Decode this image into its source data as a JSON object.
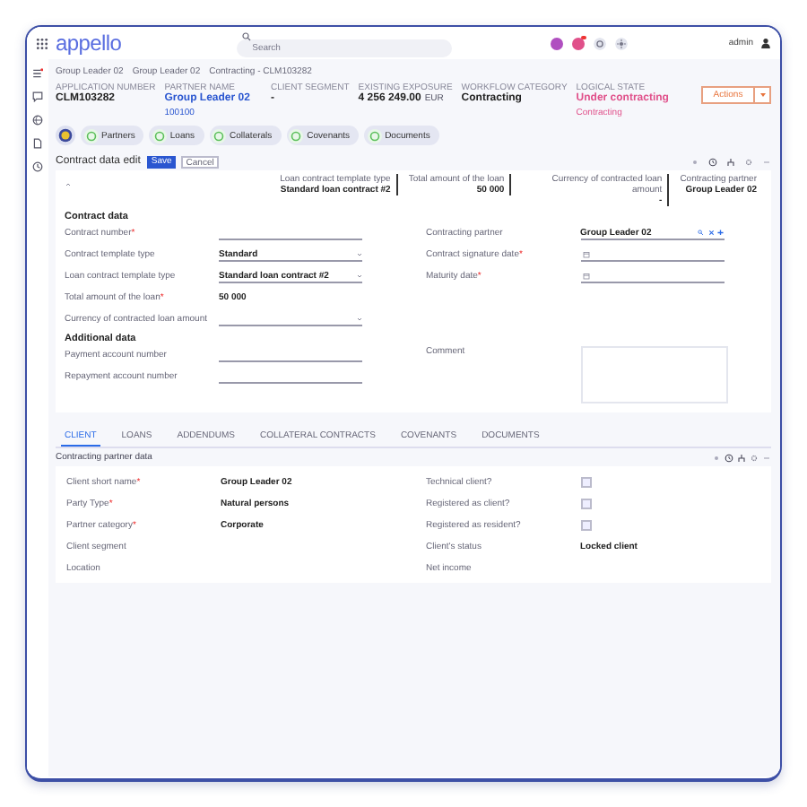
{
  "header": {
    "logo": "appello",
    "search": {
      "placeholder": "Search"
    },
    "user": "admin"
  },
  "breadcrumb": [
    "Group Leader 02",
    "Group Leader 02",
    "Contracting - CLM103282"
  ],
  "summary": [
    {
      "label": "APPLICATION NUMBER",
      "value": "CLM103282",
      "kind": "plain"
    },
    {
      "label": "PARTNER NAME",
      "value": "Group Leader 02",
      "note": "100100",
      "kind": "link"
    },
    {
      "label": "CLIENT SEGMENT",
      "value": "-",
      "kind": "plain"
    },
    {
      "label": "EXISTING EXPOSURE",
      "value": "4 256 249.00",
      "note": "EUR",
      "kind": "plain"
    },
    {
      "label": "WORKFLOW CATEGORY",
      "value": "Contracting",
      "kind": "plain"
    },
    {
      "label": "LOGICAL STATE",
      "value": "Under contracting",
      "note": "Contracting",
      "kind": "alert"
    }
  ],
  "actions_button": "Actions",
  "quick_links": [
    "Partners",
    "Loans",
    "Collaterals",
    "Covenants",
    "Documents"
  ],
  "edit": {
    "title": "Contract data edit",
    "save": "Save",
    "cancel": "Cancel",
    "strip": [
      {
        "label": "Loan contract template type",
        "value": "Standard loan contract #2"
      },
      {
        "label": "Total amount of the loan",
        "value": "50 000"
      },
      {
        "label": "Currency of contracted loan amount",
        "value": "-"
      },
      {
        "label": "Contracting partner",
        "value": "Group Leader 02"
      }
    ],
    "section": "Contract data",
    "left": [
      {
        "label": "Contract number",
        "mark": "*",
        "kind": "text"
      },
      {
        "label": "Contract template type",
        "value": "Standard",
        "kind": "select"
      },
      {
        "label": "Loan contract template type",
        "value": "Standard loan contract #2",
        "kind": "select"
      },
      {
        "label": "Total amount of the loan",
        "mark": "*",
        "value": "50 000",
        "kind": "readonly"
      },
      {
        "label": "Currency of contracted loan amount",
        "kind": "select"
      }
    ],
    "right": [
      {
        "label": "Contracting partner",
        "value": "Group Leader 02",
        "kind": "partner"
      },
      {
        "label": "Contract signature date",
        "mark": "*",
        "kind": "date"
      },
      {
        "label": "Maturity date",
        "mark": "*",
        "kind": "date"
      }
    ],
    "additional": "Additional data",
    "additional_fields": [
      {
        "label": "Payment account number",
        "kind": "text"
      },
      {
        "label": "Repayment account number",
        "kind": "text"
      }
    ],
    "comment": "Comment"
  },
  "tabs": [
    {
      "label": "CLIENT",
      "selected": true
    },
    {
      "label": "LOANS",
      "selected": false
    },
    {
      "label": "ADDENDUMS",
      "selected": false
    },
    {
      "label": "COLLATERAL CONTRACTS",
      "selected": false
    },
    {
      "label": "COVENANTS",
      "selected": false
    },
    {
      "label": "DOCUMENTS",
      "selected": false
    }
  ],
  "partner_panel": {
    "title": "Contracting partner data",
    "left": [
      {
        "label": "Client short name",
        "mark": "*",
        "value": "Group Leader 02",
        "kind": "readonly"
      },
      {
        "label": "Party Type",
        "mark": "*",
        "value": "Natural persons",
        "kind": "readonly"
      },
      {
        "label": "Partner category",
        "mark": "*",
        "value": "Corporate",
        "kind": "readonly"
      },
      {
        "label": "Client segment",
        "kind": "readonly"
      },
      {
        "label": "Location",
        "kind": "readonly"
      }
    ],
    "right": [
      {
        "label": "Technical client?",
        "kind": "checkbox",
        "checked": false
      },
      {
        "label": "Registered as client?",
        "kind": "checkbox",
        "checked": false
      },
      {
        "label": "Registered as resident?",
        "kind": "checkbox",
        "checked": false
      },
      {
        "label": "Client's status",
        "value": "Locked client",
        "kind": "readonly"
      },
      {
        "label": "Net income",
        "kind": "readonly"
      }
    ]
  }
}
